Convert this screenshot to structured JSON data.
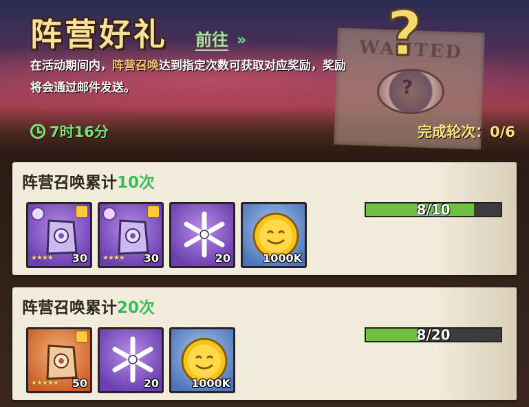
{
  "header": {
    "title": "阵营好礼",
    "goto_label": "前往",
    "goto_arrow": "»",
    "desc_pre": "在活动期间内，",
    "desc_highlight": "阵营召唤",
    "desc_post": "达到指定次数可获取对应奖励，奖励将会通过邮件发送。",
    "timer": "7时16分",
    "rounds": "完成轮次：0/6",
    "poster_text": "WANTED",
    "poster_mark": "?"
  },
  "tasks": [
    {
      "title_prefix": "阵营召唤累计",
      "count": "10次",
      "progress_label": "8/10",
      "progress": 0.8,
      "rewards": [
        {
          "icon": "purple-faction-shard-icon",
          "bg": "purple",
          "qty": "30",
          "stars": "★★★★"
        },
        {
          "icon": "purple-faction-shard-icon",
          "bg": "purple",
          "qty": "30",
          "stars": "★★★★"
        },
        {
          "icon": "snowflake-icon",
          "bg": "purple",
          "qty": "20"
        },
        {
          "icon": "gold-coin-icon",
          "bg": "blue",
          "qty": "1000K"
        }
      ]
    },
    {
      "title_prefix": "阵营召唤累计",
      "count": "20次",
      "progress_label": "8/20",
      "progress": 0.4,
      "rewards": [
        {
          "icon": "orange-faction-shard-icon",
          "bg": "orange",
          "qty": "50",
          "stars": "★★★★★"
        },
        {
          "icon": "snowflake-icon",
          "bg": "purple",
          "qty": "20"
        },
        {
          "icon": "gold-coin-icon",
          "bg": "blue",
          "qty": "1000K"
        }
      ]
    }
  ]
}
